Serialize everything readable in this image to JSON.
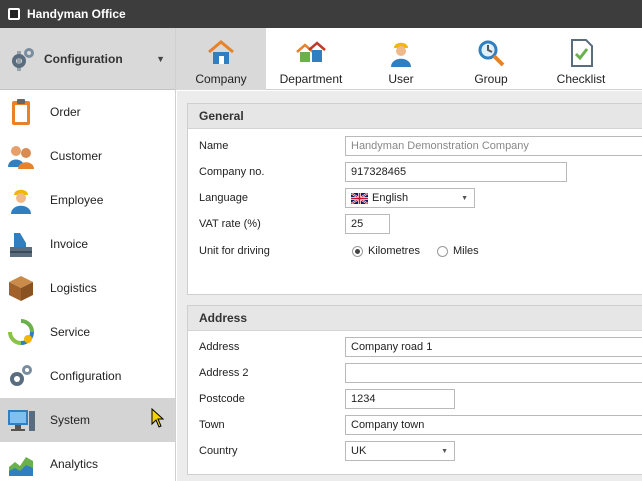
{
  "app": {
    "title": "Handyman Office"
  },
  "sidebar": {
    "header_label": "Configuration",
    "items": [
      {
        "label": "Order",
        "icon": "clipboard-icon"
      },
      {
        "label": "Customer",
        "icon": "customers-icon"
      },
      {
        "label": "Employee",
        "icon": "worker-icon"
      },
      {
        "label": "Invoice",
        "icon": "invoice-icon"
      },
      {
        "label": "Logistics",
        "icon": "box-icon"
      },
      {
        "label": "Service",
        "icon": "recycle-icon"
      },
      {
        "label": "Configuration",
        "icon": "gears-icon"
      },
      {
        "label": "System",
        "icon": "computer-icon"
      },
      {
        "label": "Analytics",
        "icon": "chart-icon"
      }
    ],
    "active_item": "System"
  },
  "tabs": [
    {
      "label": "Company",
      "icon": "house-icon"
    },
    {
      "label": "Department",
      "icon": "houses-icon"
    },
    {
      "label": "User",
      "icon": "user-icon"
    },
    {
      "label": "Group",
      "icon": "group-icon"
    },
    {
      "label": "Checklist",
      "icon": "checklist-icon"
    }
  ],
  "active_tab": "Company",
  "general": {
    "title": "General",
    "name_label": "Name",
    "name_value": "Handyman Demonstration Company",
    "company_no_label": "Company no.",
    "company_no_value": "917328465",
    "language_label": "Language",
    "language_value": "English",
    "vat_label": "VAT rate (%)",
    "vat_value": "25",
    "unit_label": "Unit for driving",
    "unit_options": [
      "Kilometres",
      "Miles"
    ],
    "unit_selected": "Kilometres"
  },
  "address": {
    "title": "Address",
    "address_label": "Address",
    "address_value": "Company road 1",
    "address2_label": "Address 2",
    "address2_value": "",
    "postcode_label": "Postcode",
    "postcode_value": "1234",
    "town_label": "Town",
    "town_value": "Company town",
    "country_label": "Country",
    "country_value": "UK"
  },
  "colors": {
    "titlebar": "#3d3d3d",
    "active_bg": "#d9d9d9",
    "content_bg": "#ececec",
    "accent_orange": "#e8822a",
    "accent_blue": "#2f7fc1"
  }
}
